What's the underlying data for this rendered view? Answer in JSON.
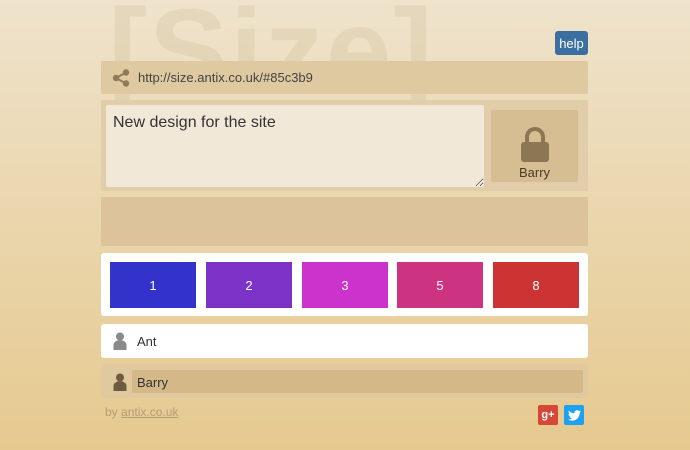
{
  "watermark": "[Size]",
  "header": {
    "help_label": "help"
  },
  "share": {
    "url": "http://size.antix.co.uk/#85c3b9",
    "icon": "share-icon"
  },
  "design": {
    "text": "New design for the site"
  },
  "lock_card": {
    "icon": "lock-icon",
    "name": "Barry"
  },
  "cards": [
    {
      "label": "1",
      "color": "#3333cc"
    },
    {
      "label": "2",
      "color": "#7d33c8"
    },
    {
      "label": "3",
      "color": "#cc33cc"
    },
    {
      "label": "5",
      "color": "#cc3380"
    },
    {
      "label": "8",
      "color": "#cc3333"
    }
  ],
  "users": [
    {
      "name": "Ant",
      "icon": "person-icon"
    },
    {
      "name": "Barry",
      "icon": "person-icon"
    }
  ],
  "footer": {
    "by_prefix": "by",
    "by_link": "antix.co.uk",
    "social": [
      {
        "label": "g+",
        "icon": "google-plus-icon",
        "color": "#d34836"
      },
      {
        "label": "t",
        "icon": "twitter-icon",
        "color": "#1da1f2"
      }
    ]
  }
}
